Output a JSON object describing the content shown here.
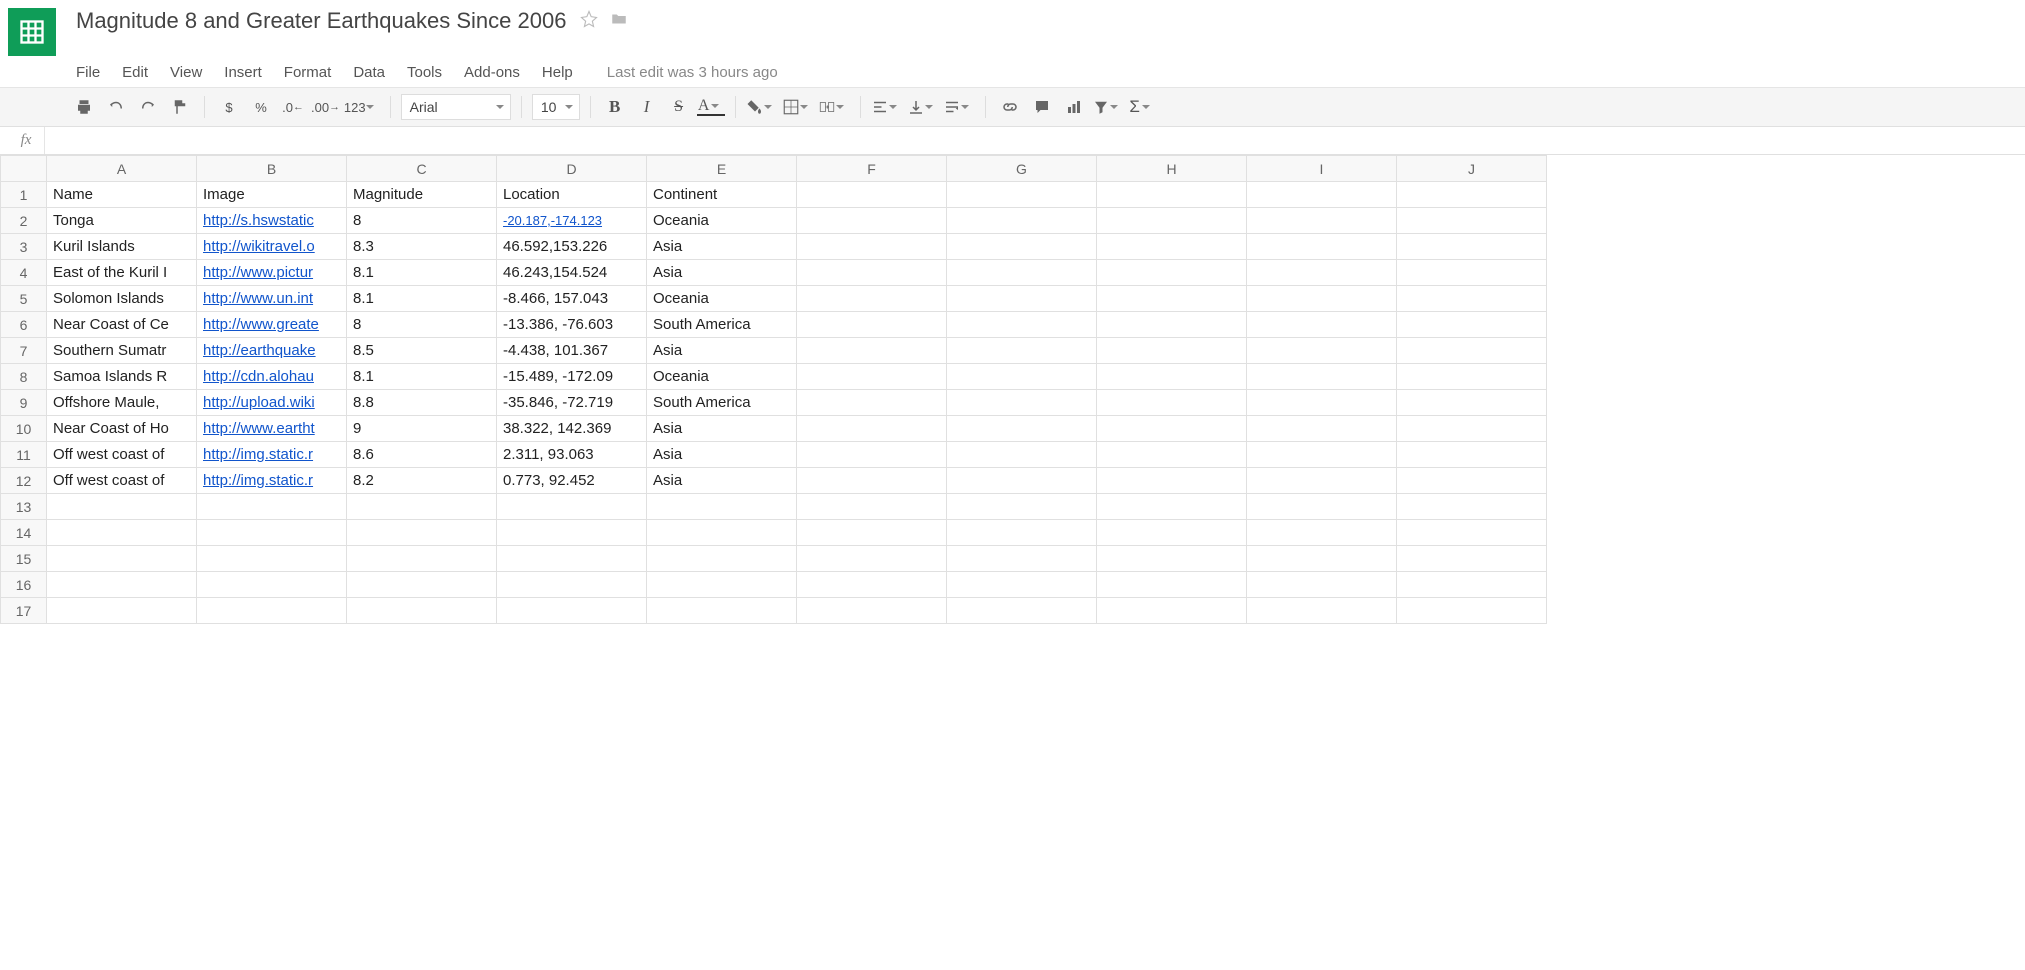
{
  "app": {
    "title": "Magnitude 8 and Greater Earthquakes Since 2006",
    "last_edit": "Last edit was 3 hours ago"
  },
  "menu": {
    "file": "File",
    "edit": "Edit",
    "view": "View",
    "insert": "Insert",
    "format": "Format",
    "data": "Data",
    "tools": "Tools",
    "addons": "Add-ons",
    "help": "Help"
  },
  "toolbar": {
    "currency": "$",
    "percent": "%",
    "dec_dec": ".0",
    "inc_dec": ".00",
    "more_fmt": "123",
    "font": "Arial",
    "font_size": "10",
    "bold": "B",
    "italic": "I",
    "strike": "S",
    "text_color": "A",
    "sigma": "Σ"
  },
  "fx": {
    "label": "fx",
    "value": ""
  },
  "columns": [
    "A",
    "B",
    "C",
    "D",
    "E",
    "F",
    "G",
    "H",
    "I",
    "J"
  ],
  "selected_col": "A",
  "header_row": [
    "Name",
    "Image",
    "Magnitude",
    "Location",
    "Continent"
  ],
  "rows": [
    {
      "name": "Tonga",
      "image": "http://s.hswstatic",
      "magnitude": "8",
      "location": "-20.187,-174.123",
      "location_is_link": true,
      "continent": "Oceania"
    },
    {
      "name": "Kuril Islands",
      "image": "http://wikitravel.o",
      "magnitude": "8.3",
      "location": "46.592,153.226",
      "continent": "Asia"
    },
    {
      "name": "East of the Kuril I",
      "image": "http://www.pictur",
      "magnitude": "8.1",
      "location": "46.243,154.524",
      "continent": "Asia"
    },
    {
      "name": "Solomon Islands",
      "image": "http://www.un.int",
      "magnitude": "8.1",
      "location": "-8.466, 157.043",
      "continent": "Oceania"
    },
    {
      "name": "Near Coast of Ce",
      "image": "http://www.greate",
      "magnitude": "8",
      "location": "-13.386, -76.603",
      "continent": "South America"
    },
    {
      "name": "Southern Sumatr",
      "image": "http://earthquake",
      "magnitude": "8.5",
      "location": "-4.438, 101.367",
      "continent": "Asia"
    },
    {
      "name": "Samoa Islands R",
      "image": "http://cdn.alohau",
      "magnitude": "8.1",
      "location": "-15.489, -172.09",
      "continent": "Oceania"
    },
    {
      "name": "Offshore Maule, ",
      "image": "http://upload.wiki",
      "magnitude": "8.8",
      "location": "-35.846, -72.719",
      "continent": "South America"
    },
    {
      "name": "Near Coast of Ho",
      "image": "http://www.eartht",
      "magnitude": "9",
      "location": "38.322, 142.369",
      "continent": "Asia"
    },
    {
      "name": "Off west coast of",
      "image": "http://img.static.r",
      "magnitude": "8.6",
      "location": "2.311, 93.063",
      "continent": "Asia"
    },
    {
      "name": "Off west coast of",
      "image": "http://img.static.r",
      "magnitude": "8.2",
      "location": "0.773, 92.452",
      "continent": "Asia"
    }
  ],
  "empty_rows_after": 5,
  "row_total": 17
}
